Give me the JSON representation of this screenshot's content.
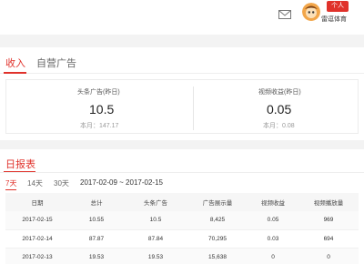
{
  "header": {
    "mail_icon": "mail-icon",
    "badge": "个人",
    "username": "雷逗体育"
  },
  "tabs": [
    {
      "label": "收入",
      "active": true
    },
    {
      "label": "自营广告",
      "active": false
    }
  ],
  "summary": {
    "left": {
      "label": "头条广告(昨日)",
      "value": "10.5",
      "month": "本月：147.17"
    },
    "right": {
      "label": "视频收益(昨日)",
      "value": "0.05",
      "month": "本月：0.08"
    }
  },
  "report": {
    "title": "日报表",
    "ranges": [
      {
        "label": "7天",
        "active": true
      },
      {
        "label": "14天",
        "active": false
      },
      {
        "label": "30天",
        "active": false
      }
    ],
    "date_range": "2017-02-09  ~  2017-02-15",
    "columns": [
      "日期",
      "总计",
      "头条广告",
      "广告展示量",
      "视频收益",
      "视频播放量"
    ],
    "rows": [
      [
        "2017-02-15",
        "10.55",
        "10.5",
        "8,425",
        "0.05",
        "969"
      ],
      [
        "2017-02-14",
        "87.87",
        "87.84",
        "70,295",
        "0.03",
        "694"
      ],
      [
        "2017-02-13",
        "19.53",
        "19.53",
        "15,638",
        "0",
        "0"
      ]
    ]
  },
  "colors": {
    "accent": "#e0322b"
  }
}
